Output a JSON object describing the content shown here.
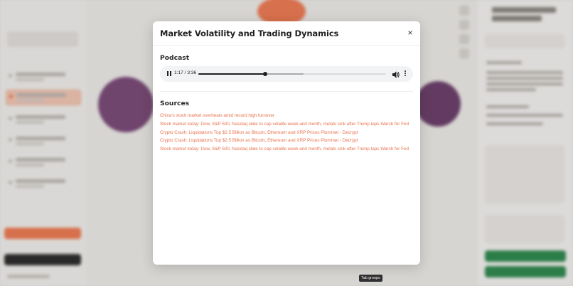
{
  "modal": {
    "title": "Market Volatility and Trading Dynamics",
    "close_symbol": "×",
    "podcast": {
      "heading": "Podcast",
      "player": {
        "time_display": "1:17 / 3:36",
        "progress_fraction": 0.356,
        "buffered_fraction": 0.56,
        "state": "playing"
      }
    },
    "sources": {
      "heading": "Sources",
      "items": [
        "China's stock market overheats amid record high turnover",
        "Stock market today: Dow, S&P 500, Nasdaq slide to cap volatile week and month, metals sink after Trump taps Warsh for Fed",
        "Crypto Crash: Liquidations Top $2.5 Billion as Bitcoin, Ethereum and XRP Prices Plummet - Decrypt",
        "Crypto Crash: Liquidations Top $2.5 Billion as Bitcoin, Ethereum and XRP Prices Plummet - Decrypt",
        "Stock market today: Dow, S&P 500, Nasdaq slide to cap volatile week and month, metals sink after Trump taps Warsh for Fed"
      ]
    }
  },
  "tooltip": {
    "text": "Tab groups"
  },
  "colors": {
    "accent": "#e8704a",
    "overlay": "#262421"
  }
}
